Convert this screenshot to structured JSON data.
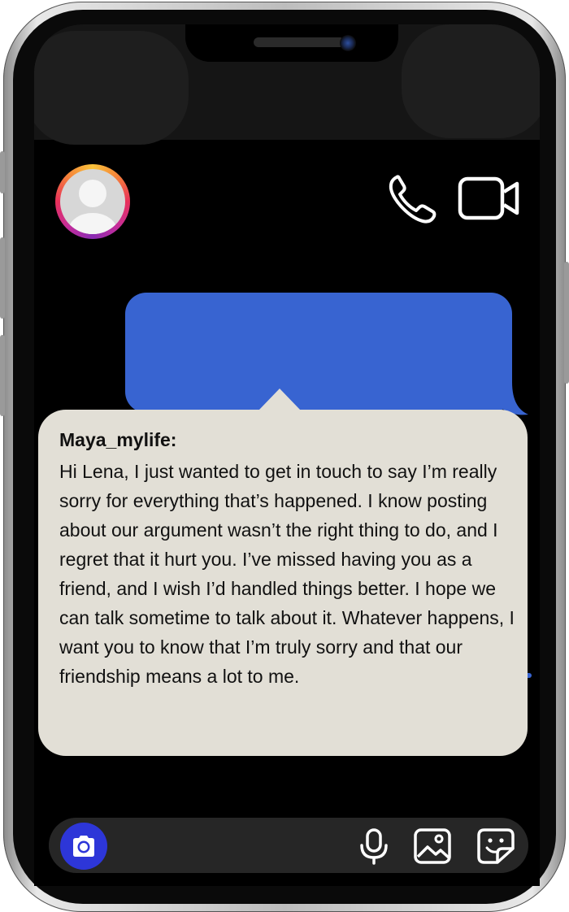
{
  "header": {
    "avatar_icon": "default-user-avatar",
    "call_icon": "phone-icon",
    "video_icon": "video-camera-icon"
  },
  "thread": {
    "outgoing_bubble_text": "",
    "incoming_message": {
      "sender": "Maya_mylife:",
      "text": "Hi Lena, I just wanted to get in touch to say I’m really sorry for everything that’s happened. I know posting about our argument wasn’t the right thing to do, and I regret that it hurt you. I’ve missed having you as a friend, and I wish I’d handled things better. I hope we can talk sometime to talk about it. Whatever happens, I want you to know that I’m truly sorry and that our friendship means a lot to me."
    }
  },
  "composer": {
    "camera_icon": "camera-icon",
    "mic_icon": "microphone-icon",
    "gallery_icon": "image-icon",
    "sticker_icon": "sticker-icon"
  },
  "colors": {
    "accent_blue": "#3864d1",
    "camera_button": "#2d36d8",
    "message_bg": "#e2dfd6",
    "screen_bg": "#000000"
  }
}
